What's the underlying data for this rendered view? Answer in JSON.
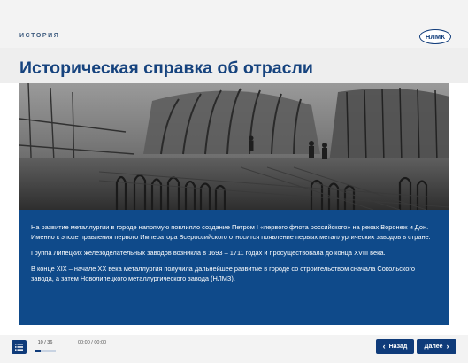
{
  "header": {
    "section_label": "ИСТОРИЯ",
    "logo_text": "НЛМК"
  },
  "main": {
    "title": "Историческая справка об отрасли",
    "paragraphs": [
      "На развитие металлургии в городе напрямую повлияло создание Петром I «первого флота российского» на реках Воронеж и Дон. Именно к эпохе правления первого Императора Всероссийского относится появление первых металлургических заводов в стране.",
      "Группа Липецких железоделательных заводов возникла в 1693 – 1711 годах и просуществовала до конца XVIII века.",
      "В конце XIX – начале XX века металлургия получила дальнейшее развитие в городе со строительством сначала Сокольского завода, а затем Новолипецкого металлургического завода (НЛМЗ)."
    ],
    "photo_icon": "historical-construction-photo",
    "panel_color": "#0f4a8a"
  },
  "footer": {
    "menu_icon": "list-menu-icon",
    "progress_label": "10 / 36",
    "progress_fraction": 0.278,
    "time_label": "00:00 / 00:00",
    "back_label": "Назад",
    "next_label": "Далее"
  },
  "colors": {
    "brand": "#0f3b7a",
    "title": "#16437e"
  }
}
